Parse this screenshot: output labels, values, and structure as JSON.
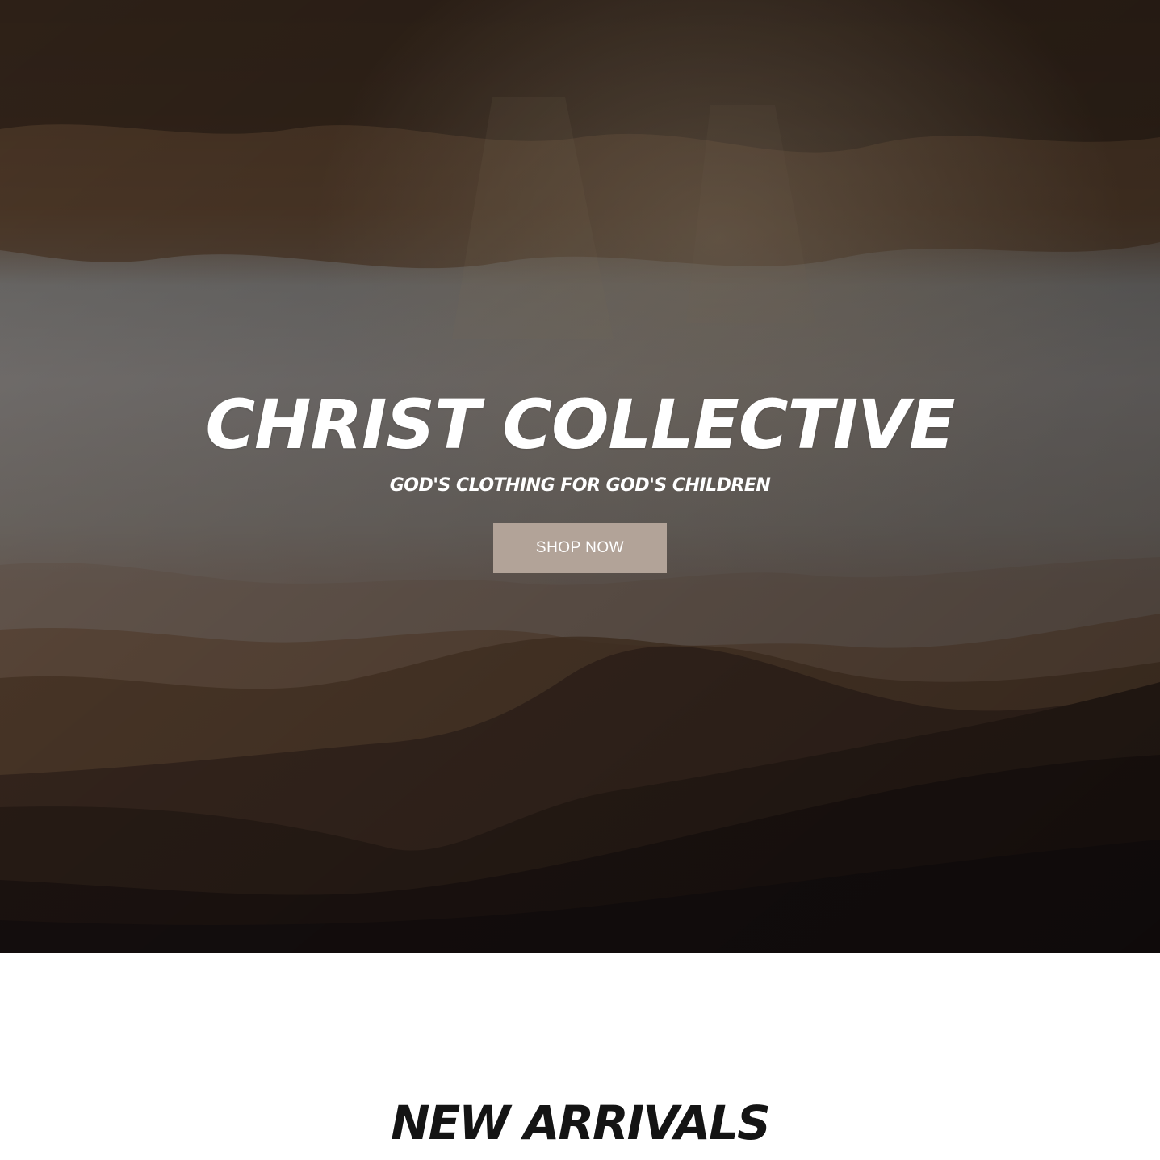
{
  "hero": {
    "title": "CHRIST COLLECTIVE",
    "subtitle": "GOD'S CLOTHING FOR GOD'S CHILDREN",
    "button_label": "SHOP NOW",
    "background_image": "mountain-sunset-landscape"
  },
  "new_arrivals": {
    "title": "NEW ARRIVALS"
  },
  "colors": {
    "button_bg": "#b2a398",
    "hero_text": "#ffffff",
    "heading_text": "#141414",
    "page_bg": "#ffffff"
  }
}
